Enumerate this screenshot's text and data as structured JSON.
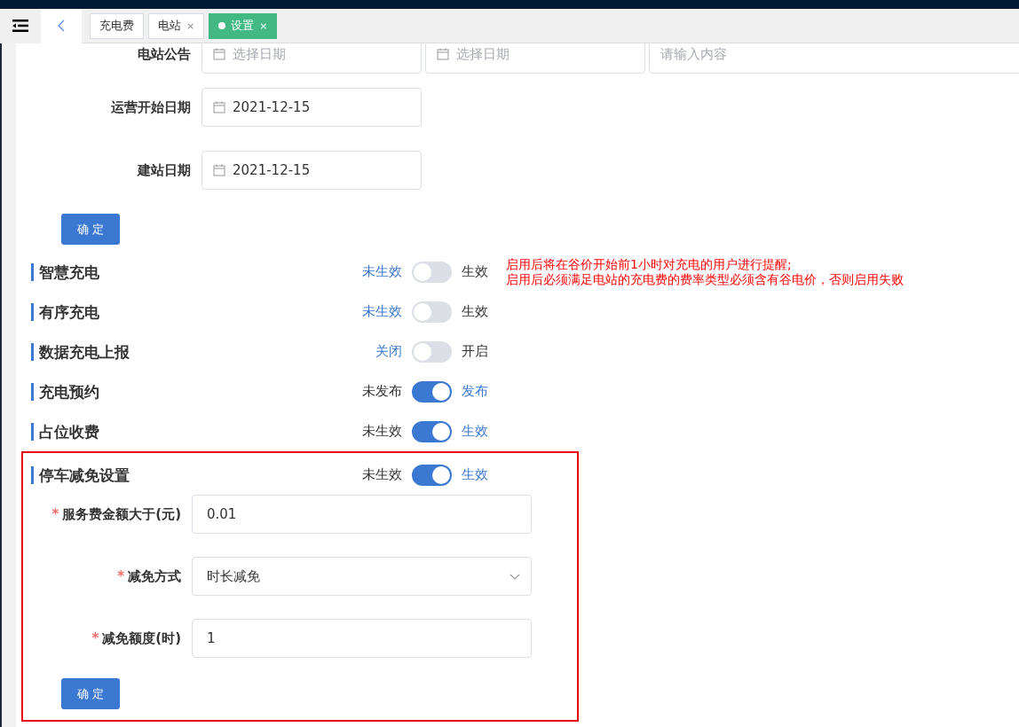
{
  "tabs": [
    {
      "label": "充电费",
      "closable": false,
      "selected": false
    },
    {
      "label": "电站",
      "closable": true,
      "selected": false
    },
    {
      "label": "设置",
      "closable": true,
      "selected": true
    }
  ],
  "close_glyph": "×",
  "announcement": {
    "label": "电站公告",
    "fields": [
      {
        "kind": "date",
        "placeholder": "选择日期"
      },
      {
        "kind": "date",
        "placeholder": "选择日期"
      },
      {
        "kind": "text",
        "placeholder": "请输入内容"
      }
    ]
  },
  "date_fields": [
    {
      "label": "运营开始日期",
      "value": "2021-12-15"
    },
    {
      "label": "建站日期",
      "value": "2021-12-15"
    }
  ],
  "confirm_button": "确 定",
  "switches": [
    {
      "title": "智慧充电",
      "off_label": "未生效",
      "on_label": "生效",
      "on": false
    },
    {
      "title": "有序充电",
      "off_label": "未生效",
      "on_label": "生效",
      "on": false
    },
    {
      "title": "数据充电上报",
      "off_label": "关闭",
      "on_label": "开启",
      "on": false
    },
    {
      "title": "充电预约",
      "off_label": "未发布",
      "on_label": "发布",
      "on": true
    },
    {
      "title": "占位收费",
      "off_label": "未生效",
      "on_label": "生效",
      "on": true
    }
  ],
  "note": [
    "启用后将在谷价开始前1小时对充电的用户进行提醒;",
    "启用后必须满足电站的充电费的费率类型必须含有谷电价，否则启用失败"
  ],
  "parking": {
    "title": "停车减免设置",
    "off_label": "未生效",
    "on_label": "生效",
    "on": true,
    "fields": [
      {
        "kind": "input",
        "label": "服务费金额大于(元)",
        "required": true,
        "value": "0.01"
      },
      {
        "kind": "select",
        "label": "减免方式",
        "required": true,
        "value": "时长减免"
      },
      {
        "kind": "input",
        "label": "减免额度(时)",
        "required": true,
        "value": "1"
      }
    ],
    "required_mark": "*",
    "button": "确 定"
  }
}
